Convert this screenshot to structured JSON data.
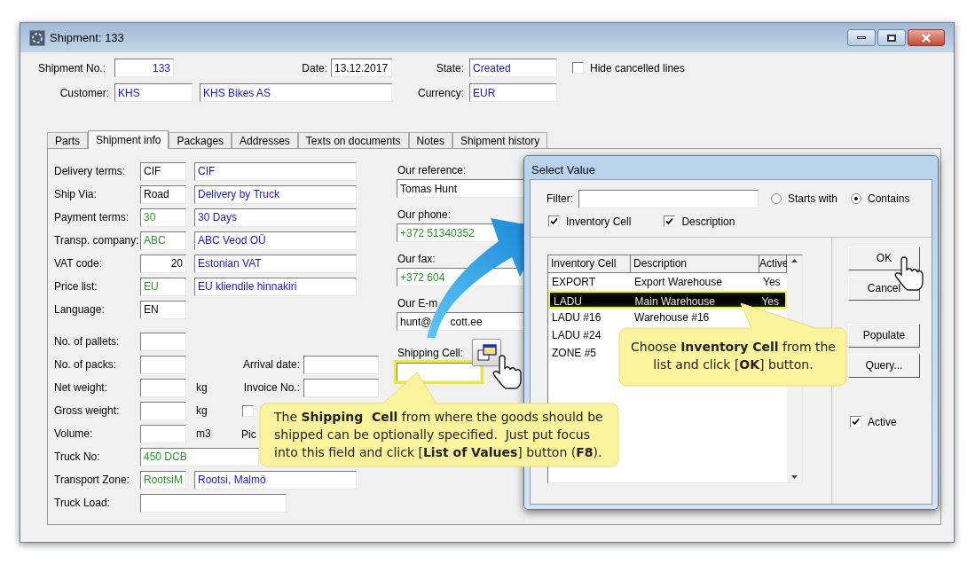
{
  "window": {
    "title": "Shipment: 133"
  },
  "shipment_no": {
    "label": "Shipment No.:",
    "value": "133"
  },
  "date": {
    "label": "Date:",
    "value": "13.12.2017"
  },
  "state": {
    "label": "State:",
    "value": "Created"
  },
  "hide_cancelled": {
    "label": "Hide cancelled lines",
    "checked": false
  },
  "customer": {
    "label": "Customer:",
    "code": "KHS",
    "name": "KHS Bikes AS"
  },
  "currency": {
    "label": "Currency:",
    "value": "EUR"
  },
  "tabs": [
    {
      "label": "Parts",
      "selected": false
    },
    {
      "label": "Shipment info",
      "selected": true
    },
    {
      "label": "Packages",
      "selected": false
    },
    {
      "label": "Addresses",
      "selected": false
    },
    {
      "label": "Texts on documents",
      "selected": false
    },
    {
      "label": "Notes",
      "selected": false
    },
    {
      "label": "Shipment history",
      "selected": false
    }
  ],
  "form_rows": [
    {
      "kind": "pair",
      "label": "Delivery terms:",
      "fields": [
        {
          "value": "CIF",
          "kind": "text"
        },
        {
          "value": "CIF",
          "kind": "description"
        }
      ]
    },
    {
      "kind": "pair",
      "label": "Ship Via:",
      "fields": [
        {
          "value": "Road",
          "kind": "text"
        },
        {
          "value": "Delivery by Truck",
          "kind": "description"
        }
      ]
    },
    {
      "kind": "pair",
      "label": "Payment terms:",
      "fields": [
        {
          "value": "30",
          "kind": "lookup"
        },
        {
          "value": "30 Days",
          "kind": "description"
        }
      ]
    },
    {
      "kind": "pair",
      "label": "Transp. company:",
      "fields": [
        {
          "value": "ABC",
          "kind": "lookup"
        },
        {
          "value": "ABC Veod OÜ",
          "kind": "description"
        }
      ]
    },
    {
      "kind": "pair",
      "label": "VAT code:",
      "fields": [
        {
          "value": "20",
          "kind": "number"
        },
        {
          "value": "Estonian VAT",
          "kind": "description"
        }
      ]
    },
    {
      "kind": "pair",
      "label": "Price list:",
      "fields": [
        {
          "value": "EU",
          "kind": "lookup"
        },
        {
          "value": "EU kliendile hinnakiri",
          "kind": "description"
        }
      ]
    },
    {
      "kind": "single",
      "label": "Language:",
      "fields": [
        {
          "value": "EN",
          "kind": "text"
        }
      ]
    }
  ],
  "measure_rows": [
    {
      "kind": "single",
      "label": "No. of pallets:",
      "fields": [
        {
          "kind": "text"
        }
      ]
    },
    {
      "kind": "single",
      "label": "No. of packs:",
      "fields": [
        {
          "kind": "text"
        }
      ],
      "side": {
        "kind": "field",
        "label": "Arrival date:"
      }
    },
    {
      "kind": "single",
      "label": "Net weight:",
      "fields": [
        {
          "kind": "text"
        }
      ],
      "unit": "kg",
      "side": {
        "kind": "field",
        "label": "Invoice No.:"
      }
    },
    {
      "kind": "single",
      "label": "Gross weight:",
      "fields": [
        {
          "kind": "text"
        }
      ],
      "unit": "kg",
      "side": {
        "kind": "checkbox",
        "checked": false
      }
    },
    {
      "kind": "single",
      "label": "Volume:",
      "fields": [
        {
          "kind": "text"
        }
      ],
      "unit": "m3",
      "side": {
        "kind": "label",
        "label": "Pic"
      }
    },
    {
      "kind": "wide",
      "label": "Truck No:",
      "fields": [
        {
          "value": "450 DCB",
          "kind": "lookup"
        }
      ]
    },
    {
      "kind": "pair",
      "label": "Transport Zone:",
      "fields": [
        {
          "value": "RootsiM",
          "kind": "lookup"
        },
        {
          "value": "Rootsi, Malmö",
          "kind": "description"
        }
      ]
    },
    {
      "kind": "medium",
      "label": "Truck Load:",
      "fields": [
        {
          "kind": "text"
        }
      ]
    }
  ],
  "contact_fields": [
    {
      "label": "Our reference:",
      "value_parts": [
        "Tomas Hunt"
      ],
      "kind": "text"
    },
    {
      "label": "Our phone:",
      "value_parts": [
        "+372 51340352"
      ],
      "kind": "lookup"
    },
    {
      "label": "Our fax:",
      "value_parts": [
        "+372 604"
      ],
      "kind": "lookup"
    },
    {
      "label": "Our E-m",
      "value_parts": [
        "hunt@",
        "cott.ee"
      ],
      "kind": "text"
    }
  ],
  "shipping_cell": {
    "label": "Shipping Cell:",
    "highlighted": true
  },
  "dialog": {
    "title": "Select Value",
    "filter": {
      "label": "Filter:"
    },
    "match_modes": [
      {
        "label": "Starts with",
        "selected": false
      },
      {
        "label": "Contains",
        "selected": true
      }
    ],
    "search_in": [
      {
        "label": "Inventory Cell",
        "checked": true
      },
      {
        "label": "Description",
        "checked": true
      }
    ],
    "columns": [
      "Inventory Cell",
      "Description",
      "Active"
    ],
    "rows": [
      {
        "cells": [
          "EXPORT",
          "Export Warehouse",
          "Yes"
        ],
        "selected": false
      },
      {
        "cells": [
          "LADU",
          "Main Warehouse",
          "Yes"
        ],
        "selected": true
      },
      {
        "cells": [
          "LADU #16",
          "Warehouse #16"
        ],
        "selected": false
      },
      {
        "cells": [
          "LADU #24"
        ],
        "selected": false
      },
      {
        "cells": [
          "ZONE #5"
        ],
        "selected": false
      }
    ],
    "buttons": [
      "OK",
      "Cancel",
      "Populate",
      "Query..."
    ],
    "active": {
      "label": "Active",
      "checked": true
    }
  },
  "callouts": [
    {
      "text": "The **Shipping  Cell** from where the goods should be shipped can be optionally specified.  Just put focus into this field and click [**List of Values**] button (**F8**)."
    },
    {
      "text": "Choose **Inventory Cell** from the list and click [**OK**] button."
    }
  ]
}
